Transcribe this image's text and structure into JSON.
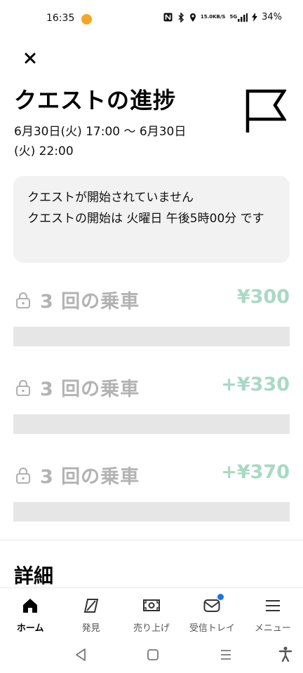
{
  "status_bar": {
    "time": "16:35",
    "network_speed_value": "15.0",
    "network_speed_unit": "KB/S",
    "network_type": "5G",
    "battery": "34%"
  },
  "header": {
    "title": "クエストの進捗",
    "date_range": "6月30日(火) 17:00 〜 6月30日(火) 22:00"
  },
  "notice": {
    "line1": "クエストが開始されていません",
    "line2": "クエストの開始は 火曜日 午後5時00分 です"
  },
  "tiers": [
    {
      "label": "3 回の乗車",
      "reward": "¥300"
    },
    {
      "label": "3 回の乗車",
      "reward": "+¥330"
    },
    {
      "label": "3 回の乗車",
      "reward": "+¥370"
    }
  ],
  "details": {
    "heading": "詳細"
  },
  "bottom_nav": [
    {
      "label": "ホーム",
      "icon": "home-icon",
      "active": true
    },
    {
      "label": "発見",
      "icon": "compass-icon"
    },
    {
      "label": "売り上げ",
      "icon": "earnings-icon"
    },
    {
      "label": "受信トレイ",
      "icon": "inbox-icon",
      "has_notification": true
    },
    {
      "label": "メニュー",
      "icon": "menu-icon"
    }
  ],
  "colors": {
    "reward_green": "#a9d9c3",
    "locked_gray": "#b3b3b3",
    "notification_blue": "#1a73e8"
  }
}
